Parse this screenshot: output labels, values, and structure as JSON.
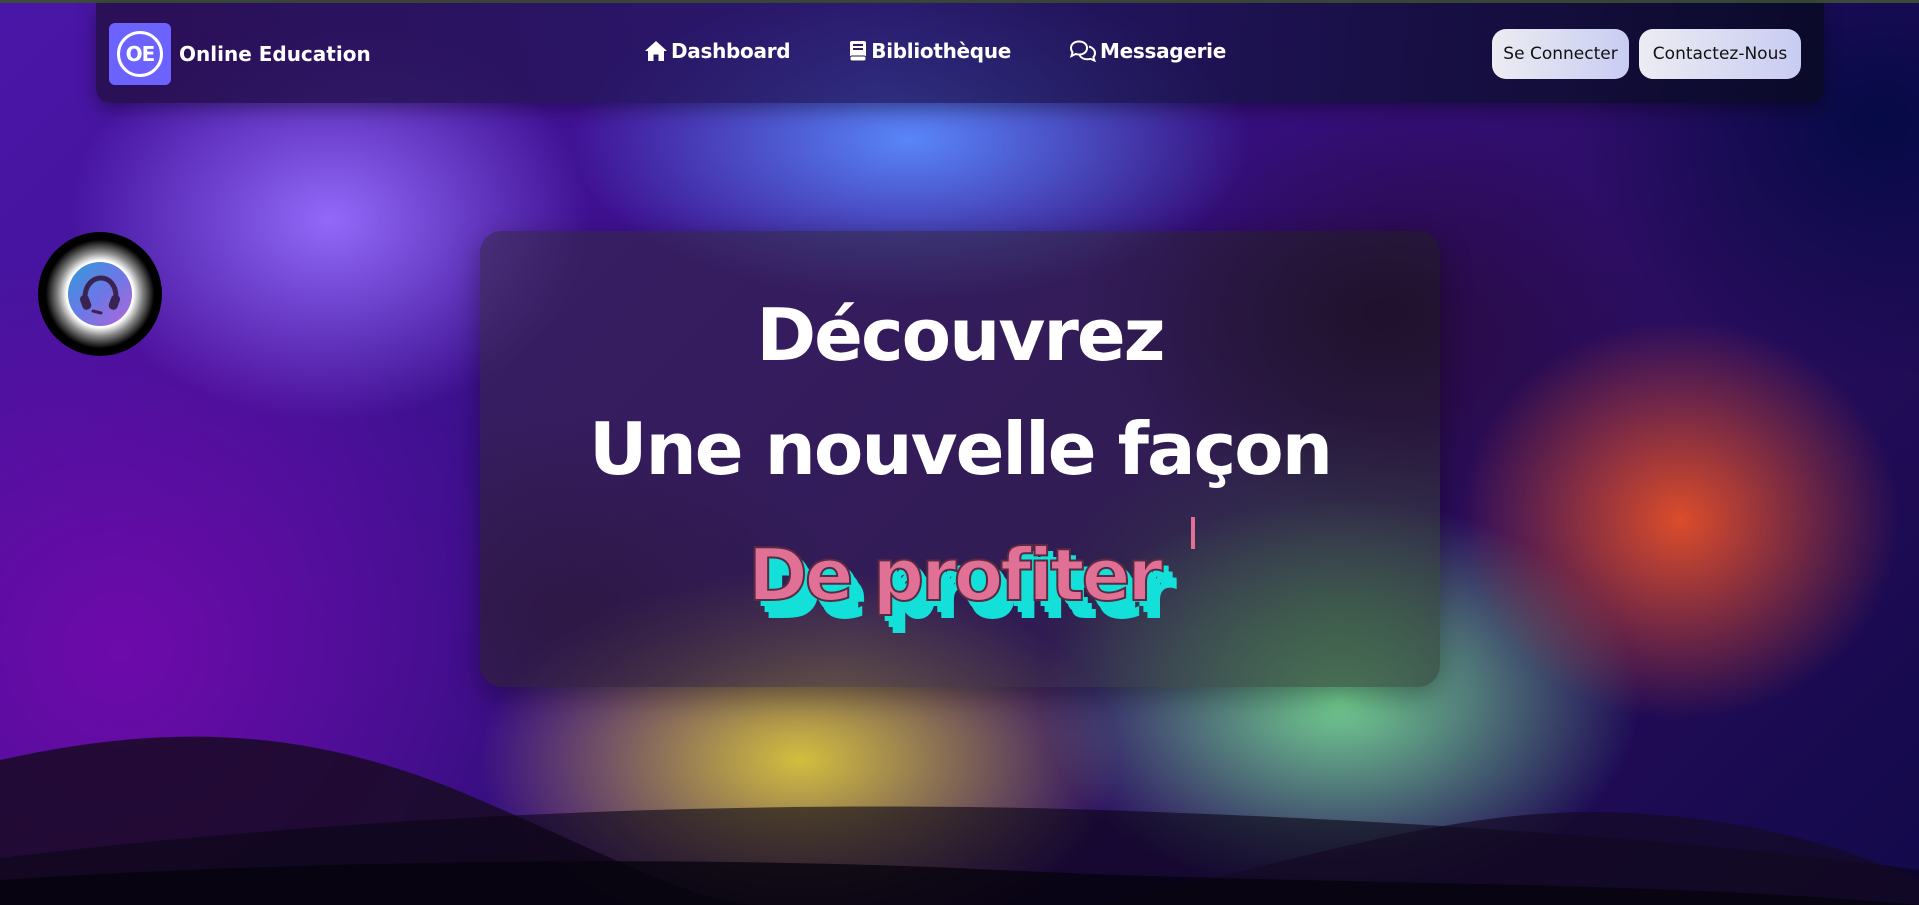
{
  "brand": {
    "logo_text": "OE",
    "name": "Online Education"
  },
  "nav": {
    "items": [
      {
        "label": "Dashboard",
        "icon": "home-icon"
      },
      {
        "label": "Bibliothèque",
        "icon": "book-icon"
      },
      {
        "label": "Messagerie",
        "icon": "chat-icon"
      }
    ]
  },
  "actions": {
    "login_label": "Se Connecter",
    "contact_label": "Contactez-Nous"
  },
  "support": {
    "icon": "headset-icon"
  },
  "hero": {
    "line1": "Découvrez",
    "line2": "Une nouvelle façon",
    "typed_text": "De profiter"
  },
  "colors": {
    "brand_logo": "#6c63ff",
    "typed_text": "#e07095",
    "typed_shadow": "#13e0d8"
  }
}
